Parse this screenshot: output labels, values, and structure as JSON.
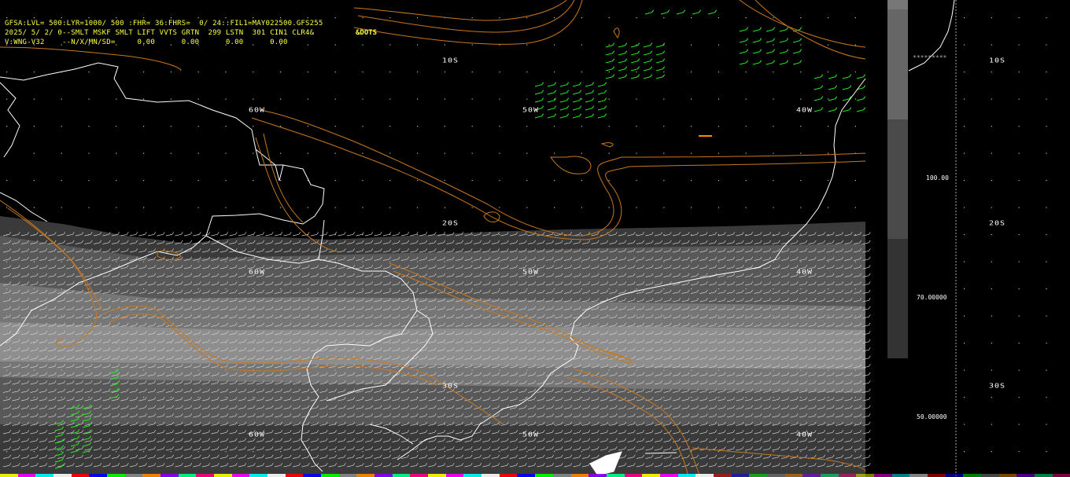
{
  "header": {
    "line1": "GFSA:LVL= 500:LYR=1000/ 500 :FHR= 36:FHRS=  0/ 24::FIL1=MAY022500.GFS255",
    "line2": "2025/ 5/ 2/ 0--SMLT MSKF SMLT LIFT VVTS GRTN  299 LSTN  301 CIN1 CLR4&",
    "line3": "V:WNG-V32    --N/X/MN/SD=     0.00      0.00      0.00      0.00",
    "dots_label": "&DOTS"
  },
  "grid_labels": {
    "lat10s": "10S",
    "lat20s": "20S",
    "lat30s": "30S",
    "lon60w": "60W",
    "lon50w": "50W",
    "lon40w": "40W"
  },
  "scale": {
    "stars": "*********",
    "labels": [
      "100.00",
      "70.00000",
      "50.00000"
    ],
    "right_labels": [
      "10S",
      "20S",
      "30S"
    ]
  },
  "colors": {
    "header_text": "#ffff44",
    "contour": "#c8781e",
    "wind_barb_green": "#22ee22",
    "coast": "#ffffff",
    "shade_dark": "#3a3a3a",
    "shade_mid": "#6a6a6a",
    "shade_light": "#9a9a9a"
  },
  "palette_colors": [
    "#ffff00",
    "#ff00ff",
    "#00ffff",
    "#ffffff",
    "#ff0000",
    "#0000ff",
    "#00ff00",
    "#888888",
    "#ff8800",
    "#8800ff",
    "#00ff88",
    "#ff0088"
  ]
}
